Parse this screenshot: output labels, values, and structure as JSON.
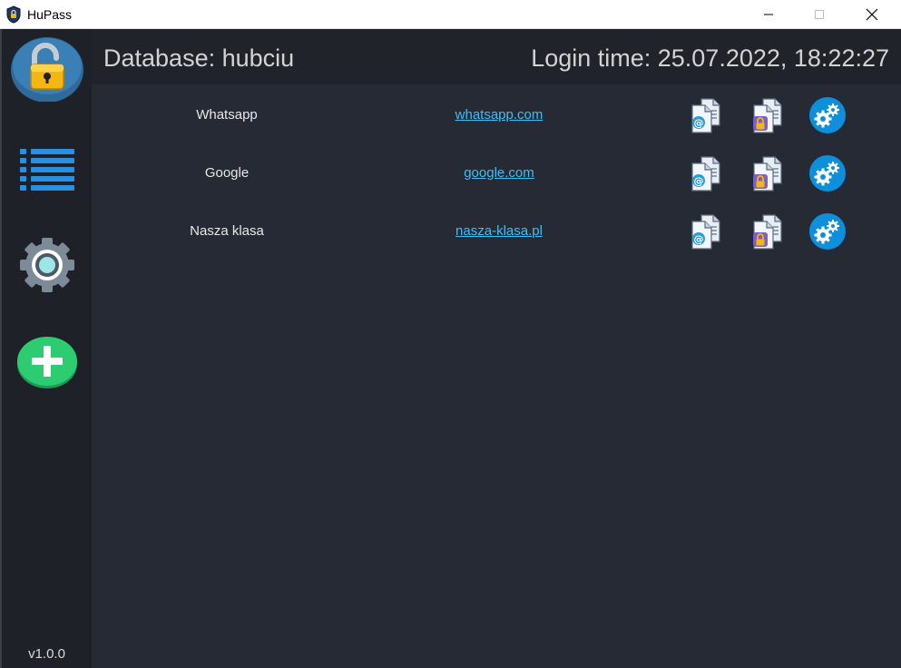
{
  "window": {
    "title": "HuPass"
  },
  "sidebar": {
    "version": "v1.0.0",
    "items": [
      {
        "icon": "unlocked-padlock-icon"
      },
      {
        "icon": "list-icon"
      },
      {
        "icon": "settings-gear-icon"
      },
      {
        "icon": "add-icon"
      }
    ]
  },
  "header": {
    "database": "Database: hubciu",
    "login_time": "Login time: 25.07.2022, 18:22:27"
  },
  "entries": [
    {
      "name": "Whatsapp",
      "url": "whatsapp.com"
    },
    {
      "name": "Google",
      "url": "google.com"
    },
    {
      "name": "Nasza klasa",
      "url": "nasza-klasa.pl"
    }
  ],
  "row_actions": [
    {
      "icon": "copy-email-icon"
    },
    {
      "icon": "copy-password-icon"
    },
    {
      "icon": "entry-settings-icon"
    }
  ],
  "colors": {
    "background": "#252a34",
    "sidebar": "#1e2128",
    "header": "#202329",
    "link": "#3fbdf5",
    "settings_blue": "#0e8fdc",
    "add_green": "#2ecc71",
    "lock_yellow": "#f5b512"
  }
}
